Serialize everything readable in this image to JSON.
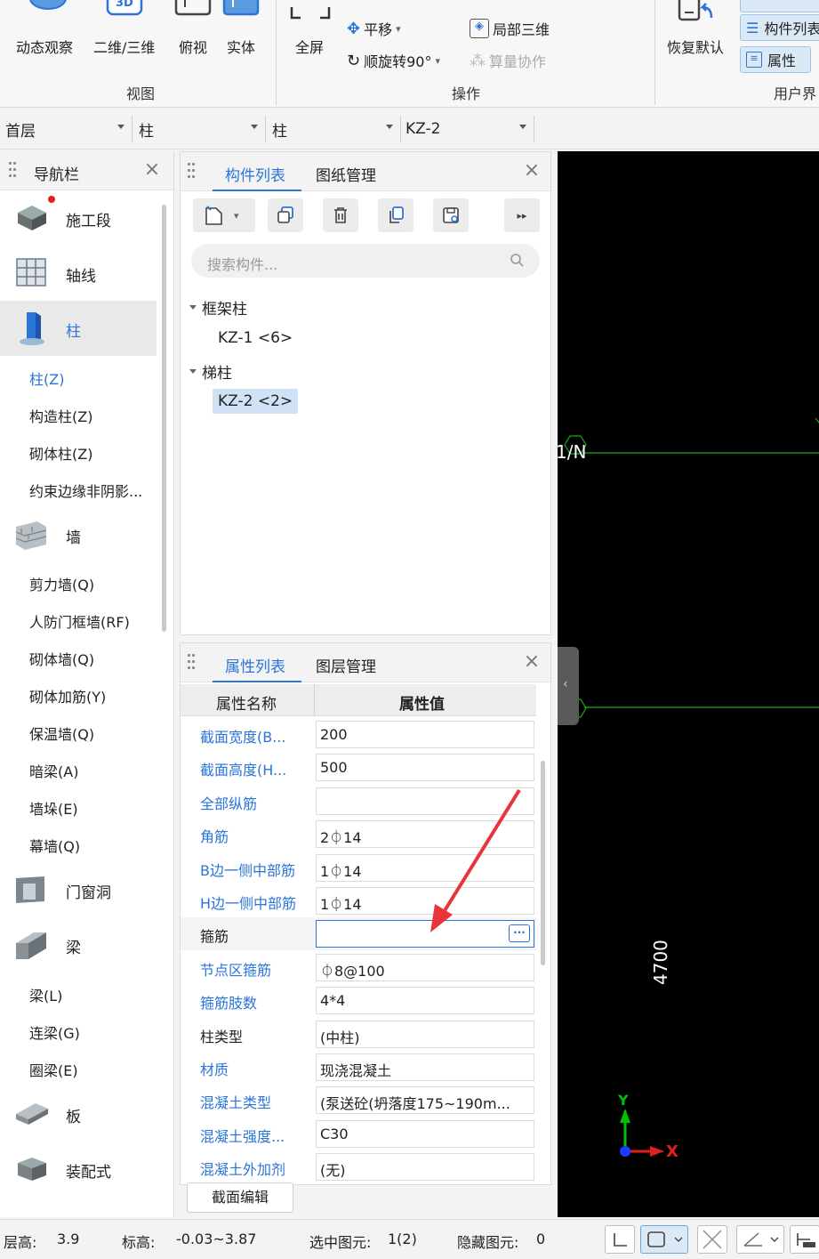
{
  "ribbon": {
    "view_buttons": [
      {
        "label": "动态观察",
        "icon": "orbit-icon"
      },
      {
        "label": "二维/三维",
        "icon": "2d-3d-toggle-icon",
        "icon_text": "3D"
      },
      {
        "label": "俯视",
        "icon": "top-view-icon"
      },
      {
        "label": "实体",
        "icon": "solid-view-icon"
      }
    ],
    "group_view": "视图",
    "fullscreen_label": "全屏",
    "op_pan": "平移",
    "op_rotate": "顺旋转90°",
    "op_local3d": "局部三维",
    "op_collab": "算量协作",
    "group_ops": "操作",
    "restore_label": "恢复默认",
    "ui_component_list": "构件列表",
    "ui_properties": "属性",
    "group_ui": "用户界"
  },
  "dropdowns": {
    "floor": "首层",
    "category": "柱",
    "type": "柱",
    "component": "KZ-2"
  },
  "nav": {
    "title": "导航栏",
    "categories": [
      {
        "label": "施工段",
        "icon": "construction-stage-icon",
        "badge": true
      },
      {
        "label": "轴线",
        "icon": "axis-grid-icon"
      },
      {
        "label": "柱",
        "icon": "column-icon",
        "active": true
      },
      {
        "label": "墙",
        "icon": "wall-icon"
      },
      {
        "label": "门窗洞",
        "icon": "door-window-icon"
      },
      {
        "label": "梁",
        "icon": "beam-icon"
      },
      {
        "label": "板",
        "icon": "slab-icon"
      },
      {
        "label": "装配式",
        "icon": "prefab-icon"
      }
    ],
    "column_items": [
      "柱(Z)",
      "构造柱(Z)",
      "砌体柱(Z)",
      "约束边缘非阴影..."
    ],
    "wall_items": [
      "剪力墙(Q)",
      "人防门框墙(RF)",
      "砌体墙(Q)",
      "砌体加筋(Y)",
      "保温墙(Q)",
      "暗梁(A)",
      "墙垛(E)",
      "幕墙(Q)"
    ],
    "beam_items": [
      "梁(L)",
      "连梁(G)",
      "圈梁(E)"
    ]
  },
  "component_panel": {
    "tabs": [
      "构件列表",
      "图纸管理"
    ],
    "search_placeholder": "搜索构件...",
    "groups": [
      {
        "label": "框架柱",
        "items": [
          {
            "label": "KZ-1 <6>",
            "selected": false
          }
        ]
      },
      {
        "label": "梯柱",
        "items": [
          {
            "label": "KZ-2 <2>",
            "selected": true
          }
        ]
      }
    ]
  },
  "property_panel": {
    "tabs": [
      "属性列表",
      "图层管理"
    ],
    "col_name": "属性名称",
    "col_value": "属性值",
    "rows": [
      {
        "name": "截面宽度(B...",
        "value": "200",
        "blue": true
      },
      {
        "name": "截面高度(H...",
        "value": "500",
        "blue": true
      },
      {
        "name": "全部纵筋",
        "value": "",
        "blue": true
      },
      {
        "name": "角筋",
        "value": "2⏀14",
        "blue": true
      },
      {
        "name": "B边一侧中部筋",
        "value": "1⏀14",
        "blue": true
      },
      {
        "name": "H边一侧中部筋",
        "value": "1⏀14",
        "blue": true
      },
      {
        "name": "箍筋",
        "value": "",
        "blue": false,
        "focused": true
      },
      {
        "name": "节点区箍筋",
        "value": "⏀8@100",
        "blue": true
      },
      {
        "name": "箍筋肢数",
        "value": "4*4",
        "blue": true
      },
      {
        "name": "柱类型",
        "value": "(中柱)",
        "blue": false
      },
      {
        "name": "材质",
        "value": "现浇混凝土",
        "blue": true
      },
      {
        "name": "混凝土类型",
        "value": "(泵送砼(坍落度175~190m...",
        "blue": true
      },
      {
        "name": "混凝土强度...",
        "value": "C30",
        "blue": true
      },
      {
        "name": "混凝土外加剂",
        "value": "(无)",
        "blue": true
      }
    ],
    "section_edit_label": "截面编辑"
  },
  "canvas": {
    "axis_label": "1/N",
    "dimension": "4700",
    "axis_x": "X",
    "axis_y": "Y"
  },
  "status": {
    "floor_height_label": "层高:",
    "floor_height": "3.9",
    "elevation_label": "标高:",
    "elevation": "-0.03~3.87",
    "selected_label": "选中图元:",
    "selected": "1(2)",
    "hidden_label": "隐藏图元:",
    "hidden": "0"
  },
  "colors": {
    "accent": "#2b74d8",
    "canvas_bg": "#000000",
    "canvas_line": "#1fa81f",
    "annotation_arrow": "#e8343a"
  }
}
